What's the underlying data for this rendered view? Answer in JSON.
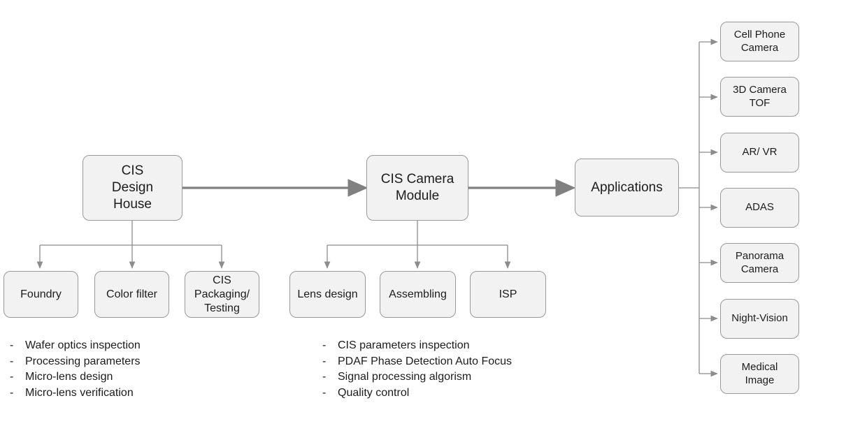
{
  "diagram": {
    "title": "CIS value chain and applications flow diagram",
    "colors": {
      "node_fill": "#f2f2f2",
      "node_border": "#999999",
      "thick_arrow": "#808080",
      "thin_arrow": "#8c8c8c",
      "text": "#1c1c1c",
      "background": "#ffffff"
    },
    "main_nodes": [
      {
        "id": "cis-design-house",
        "label": "CIS\nDesign\nHouse"
      },
      {
        "id": "cis-camera-module",
        "label": "CIS Camera\nModule"
      },
      {
        "id": "applications",
        "label": "Applications"
      }
    ],
    "design_house_children": [
      {
        "id": "foundry",
        "label": "Foundry"
      },
      {
        "id": "color-filter",
        "label": "Color filter"
      },
      {
        "id": "cis-packaging-testing",
        "label": "CIS\nPackaging/\nTesting"
      }
    ],
    "camera_module_children": [
      {
        "id": "lens-design",
        "label": "Lens design"
      },
      {
        "id": "assembling",
        "label": "Assembling"
      },
      {
        "id": "isp",
        "label": "ISP"
      }
    ],
    "applications_children": [
      {
        "id": "cell-phone-camera",
        "label": "Cell Phone\nCamera"
      },
      {
        "id": "3d-camera-tof",
        "label": "3D Camera\nTOF"
      },
      {
        "id": "ar-vr",
        "label": "AR/ VR"
      },
      {
        "id": "adas",
        "label": "ADAS"
      },
      {
        "id": "panorama-camera",
        "label": "Panorama\nCamera"
      },
      {
        "id": "night-vision",
        "label": "Night-Vision"
      },
      {
        "id": "medical-image",
        "label": "Medical\nImage"
      }
    ],
    "notes_left": {
      "marker": "-",
      "items": [
        "Wafer optics inspection",
        "Processing parameters",
        "Micro-lens design",
        "Micro-lens verification"
      ]
    },
    "notes_middle": {
      "marker": "-",
      "items": [
        "CIS parameters inspection",
        "PDAF Phase Detection Auto Focus",
        "Signal processing algorism",
        "Quality control"
      ]
    }
  }
}
